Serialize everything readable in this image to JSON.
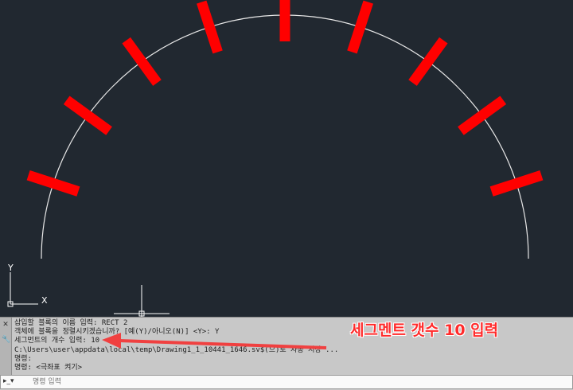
{
  "app": {
    "ucs": {
      "y_label": "Y",
      "x_label": "X"
    }
  },
  "drawing": {
    "segment_count": 10,
    "segment_color": "#ff0000",
    "arc_color": "#e8e8e8",
    "background": "#212830"
  },
  "command_line": {
    "history": [
      "삽입할 블록의 이름 입력: RECT 2",
      "객체에 블록을 정렬시키겠습니까? [예(Y)/아니오(N)] <Y>: Y",
      "세그먼트의 개수 입력: 10",
      "C:\\Users\\user\\appdata\\local\\temp\\Drawing1_1_10441_1646.sv$(으)로 자동 저장 ...",
      "명령:",
      "명령:  <극좌표 켜기>"
    ],
    "input_placeholder": "명령 입력"
  },
  "annotation": {
    "text": "세그멘트 갯수 10 입력",
    "color": "#ff2b2b"
  }
}
